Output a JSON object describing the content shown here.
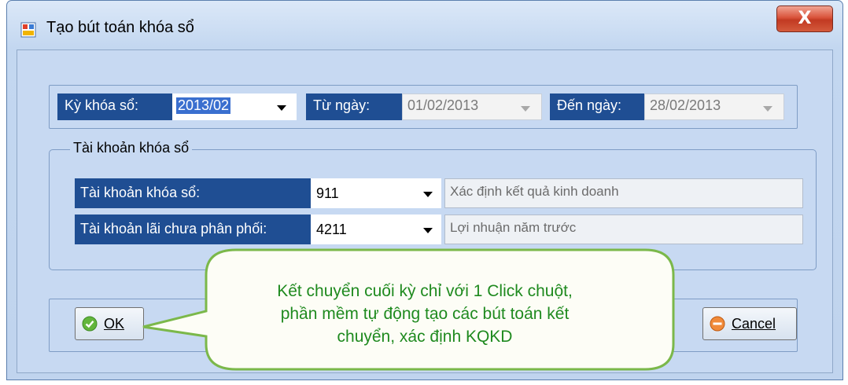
{
  "window": {
    "title": "Tạo bút toán khóa sổ",
    "close_glyph": "X"
  },
  "period": {
    "ky_label": "Kỳ khóa sổ:",
    "ky_value": "2013/02",
    "tu_label": "Từ ngày:",
    "tu_value": "01/02/2013",
    "den_label": "Đến ngày:",
    "den_value": "28/02/2013"
  },
  "accounts": {
    "group_label": "Tài khoản khóa sổ",
    "rows": [
      {
        "label": "Tài khoản khóa sổ:",
        "value": "911",
        "description": "Xác định kết quả kinh doanh"
      },
      {
        "label": "Tài khoản lãi chưa phân phối:",
        "value": "4211",
        "description": "Lợi nhuận năm trước"
      }
    ]
  },
  "buttons": {
    "ok": "OK",
    "cancel": "Cancel"
  },
  "callout": {
    "line1": "Kết chuyển cuối kỳ chỉ với 1 Click chuột,",
    "line2": "phần mềm tự động tạo các bút toán kết",
    "line3": "chuyển, xác định KQKD"
  },
  "colors": {
    "label_bg": "#1f4e93",
    "callout_text": "#1f8a1f",
    "callout_border": "#7bb84a"
  },
  "icons": {
    "app": "form-app-icon",
    "ok": "check-circle-icon",
    "cancel": "minus-circle-icon"
  }
}
